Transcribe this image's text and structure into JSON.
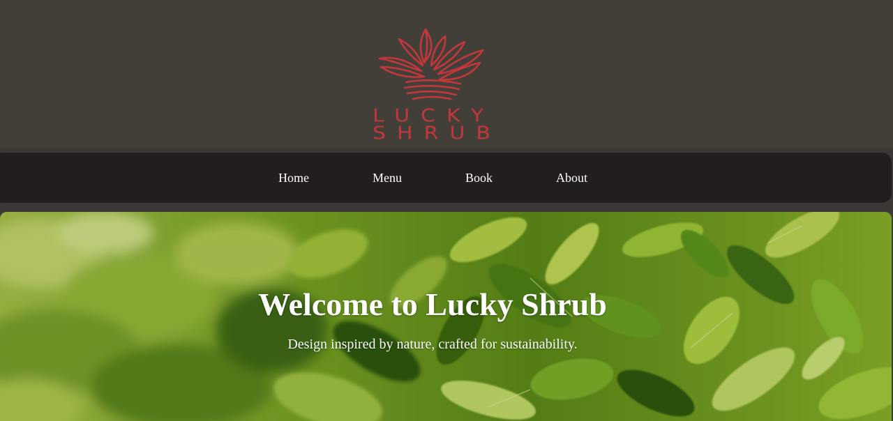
{
  "brand": {
    "line1": "LUCKY",
    "line2": "SHRUB",
    "logo_icon": "lotus-plant-icon",
    "accent_color": "#c2373b"
  },
  "nav": {
    "items": [
      {
        "label": "Home"
      },
      {
        "label": "Menu"
      },
      {
        "label": "Book"
      },
      {
        "label": "About"
      }
    ]
  },
  "hero": {
    "title": "Welcome to Lucky Shrub",
    "subtitle": "Design inspired by nature, crafted for sustainability.",
    "background_image": "tea-leaves-photo"
  },
  "colors": {
    "header_bg": "#423f38",
    "nav_bg": "#221e1f",
    "nav_text": "#ffffff",
    "hero_text": "#ffffff"
  }
}
